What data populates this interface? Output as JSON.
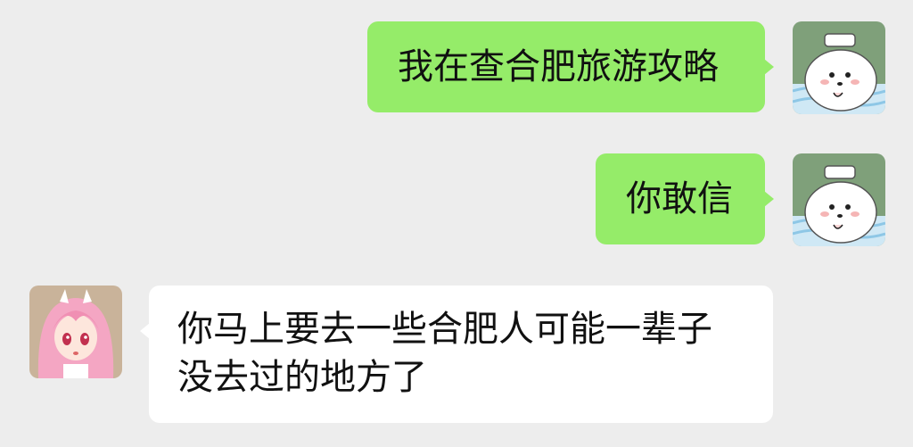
{
  "messages": [
    {
      "direction": "sent",
      "text": "我在查合肥旅游攻略",
      "avatar": "dog-avatar-icon"
    },
    {
      "direction": "sent",
      "text": "你敢信",
      "avatar": "dog-avatar-icon"
    },
    {
      "direction": "received",
      "lines": [
        "你马上要去一些合肥人可能一辈子",
        "没去过的地方了"
      ],
      "avatar": "anime-girl-avatar-icon"
    }
  ],
  "colors": {
    "background": "#ededed",
    "sent_bubble": "#95ec69",
    "received_bubble": "#ffffff",
    "text": "#111111"
  }
}
